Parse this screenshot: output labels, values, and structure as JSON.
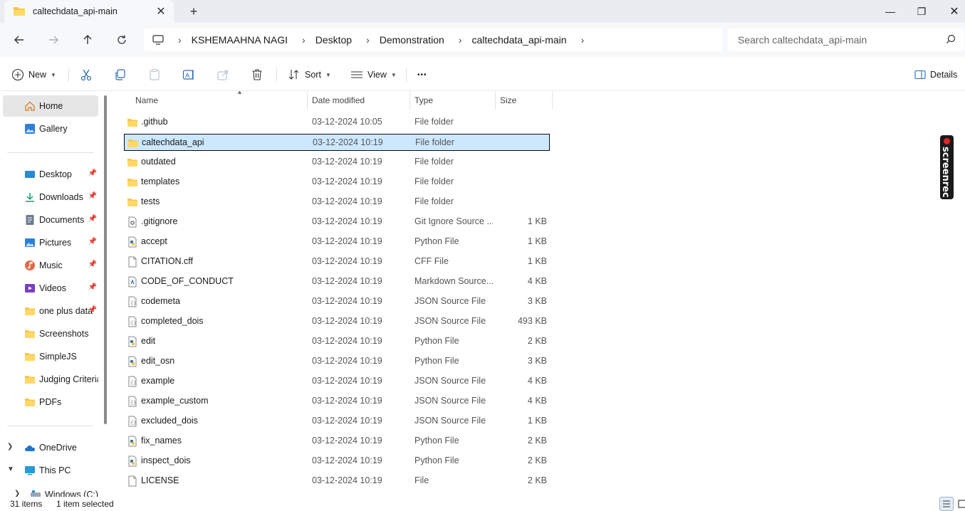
{
  "tab": {
    "title": "caltechdata_api-main",
    "close": "✕",
    "new": "+"
  },
  "window": {
    "minimize": "—",
    "maximize": "❐",
    "close": "✕"
  },
  "breadcrumb": [
    "KSHEMAAHNA NAGI",
    "Desktop",
    "Demonstration",
    "caltechdata_api-main"
  ],
  "breadcrumb_sep": "›",
  "search": {
    "placeholder": "Search caltechdata_api-main"
  },
  "toolbar": {
    "new_label": "New",
    "sort_label": "Sort",
    "view_label": "View",
    "more_label": "•••",
    "details_label": "Details"
  },
  "sidebar": {
    "home": "Home",
    "gallery": "Gallery",
    "desktop": "Desktop",
    "downloads": "Downloads",
    "documents": "Documents",
    "pictures": "Pictures",
    "music": "Music",
    "videos": "Videos",
    "oneplus": "one plus data",
    "screenshots": "Screenshots",
    "simplejs": "SimpleJS",
    "judging": "Judging Criteria",
    "pdfs": "PDFs",
    "onedrive": "OneDrive",
    "thispc": "This PC",
    "windowsc": "Windows (C:)",
    "pin": "📌",
    "expand": "›",
    "collapse": "⌄"
  },
  "columns": {
    "name": "Name",
    "date": "Date modified",
    "type": "Type",
    "size": "Size"
  },
  "files": [
    {
      "name": ".github",
      "date": "03-12-2024 10:05",
      "type": "File folder",
      "size": "",
      "icon": "folder-icon"
    },
    {
      "name": "caltechdata_api",
      "date": "03-12-2024 10:19",
      "type": "File folder",
      "size": "",
      "icon": "folder-icon"
    },
    {
      "name": "outdated",
      "date": "03-12-2024 10:19",
      "type": "File folder",
      "size": "",
      "icon": "folder-icon"
    },
    {
      "name": "templates",
      "date": "03-12-2024 10:19",
      "type": "File folder",
      "size": "",
      "icon": "folder-icon"
    },
    {
      "name": "tests",
      "date": "03-12-2024 10:19",
      "type": "File folder",
      "size": "",
      "icon": "folder-icon"
    },
    {
      "name": ".gitignore",
      "date": "03-12-2024 10:19",
      "type": "Git Ignore Source ...",
      "size": "1 KB",
      "icon": "gear-file-icon"
    },
    {
      "name": "accept",
      "date": "03-12-2024 10:19",
      "type": "Python File",
      "size": "1 KB",
      "icon": "python-file-icon"
    },
    {
      "name": "CITATION.cff",
      "date": "03-12-2024 10:19",
      "type": "CFF File",
      "size": "1 KB",
      "icon": "blank-file-icon"
    },
    {
      "name": "CODE_OF_CONDUCT",
      "date": "03-12-2024 10:19",
      "type": "Markdown Source...",
      "size": "4 KB",
      "icon": "markdown-file-icon"
    },
    {
      "name": "codemeta",
      "date": "03-12-2024 10:19",
      "type": "JSON Source File",
      "size": "3 KB",
      "icon": "json-file-icon"
    },
    {
      "name": "completed_dois",
      "date": "03-12-2024 10:19",
      "type": "JSON Source File",
      "size": "493 KB",
      "icon": "json-file-icon"
    },
    {
      "name": "edit",
      "date": "03-12-2024 10:19",
      "type": "Python File",
      "size": "2 KB",
      "icon": "python-file-icon"
    },
    {
      "name": "edit_osn",
      "date": "03-12-2024 10:19",
      "type": "Python File",
      "size": "3 KB",
      "icon": "python-file-icon"
    },
    {
      "name": "example",
      "date": "03-12-2024 10:19",
      "type": "JSON Source File",
      "size": "4 KB",
      "icon": "json-file-icon"
    },
    {
      "name": "example_custom",
      "date": "03-12-2024 10:19",
      "type": "JSON Source File",
      "size": "4 KB",
      "icon": "json-file-icon"
    },
    {
      "name": "excluded_dois",
      "date": "03-12-2024 10:19",
      "type": "JSON Source File",
      "size": "1 KB",
      "icon": "json-file-icon"
    },
    {
      "name": "fix_names",
      "date": "03-12-2024 10:19",
      "type": "Python File",
      "size": "2 KB",
      "icon": "python-file-icon"
    },
    {
      "name": "inspect_dois",
      "date": "03-12-2024 10:19",
      "type": "Python File",
      "size": "2 KB",
      "icon": "python-file-icon"
    },
    {
      "name": "LICENSE",
      "date": "03-12-2024 10:19",
      "type": "File",
      "size": "2 KB",
      "icon": "blank-file-icon"
    }
  ],
  "status": {
    "items": "31 items",
    "selected": "1 item selected"
  },
  "watermark": "screenrec",
  "colors": {
    "selection": "#cce8ff",
    "folder": "#f4c64e",
    "accent": "#0067c0"
  }
}
